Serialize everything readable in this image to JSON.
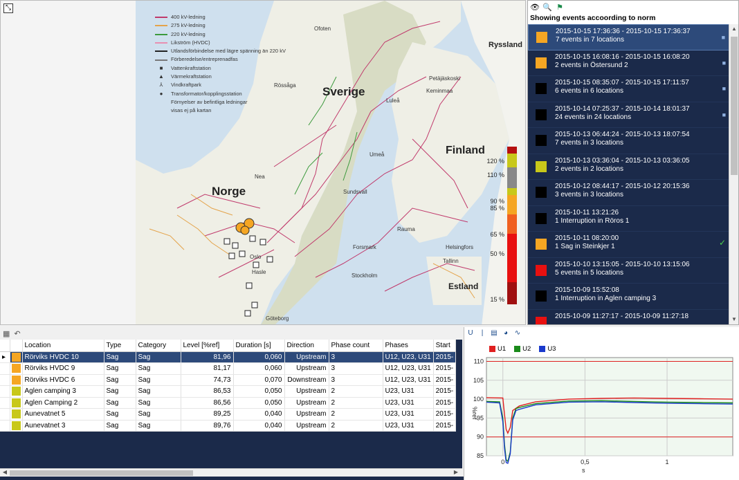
{
  "map": {
    "expand_icon": "expand-icon",
    "legend": [
      {
        "label": "400 kV-ledning",
        "color": "#c0396b",
        "kind": "line"
      },
      {
        "label": "275 kV-ledning",
        "color": "#e4a34a",
        "kind": "line"
      },
      {
        "label": "220 kV-ledning",
        "color": "#3c9a3c",
        "kind": "line"
      },
      {
        "label": "Likström (HVDC)",
        "color": "#e88fb0",
        "kind": "line"
      },
      {
        "label": "Utlandsförbindelse med lägre spänning än 220 kV",
        "color": "#222222",
        "kind": "line"
      },
      {
        "label": "Förberedelse/entreprenadfas",
        "color": "#777777",
        "kind": "line"
      },
      {
        "label": "Vattenkraftstation",
        "symbol": "■",
        "kind": "symbol"
      },
      {
        "label": "Värmekraftstation",
        "symbol": "▲",
        "kind": "symbol"
      },
      {
        "label": "Vindkraftpark",
        "symbol": "⅄",
        "kind": "symbol"
      },
      {
        "label": "Transformator/kopplingsstation",
        "symbol": "●",
        "kind": "symbol"
      },
      {
        "label": "Förnyelser av befintliga ledningar",
        "kind": "note"
      },
      {
        "label": "visas ej på kartan",
        "kind": "note"
      }
    ],
    "countries": {
      "norge": "Norge",
      "sverige": "Sverige",
      "finland": "Finland",
      "estland": "Estland",
      "ryssland": "Ryssland"
    },
    "cities": {
      "ofoten": "Ofoten",
      "rossaga": "Rössåga",
      "lulea": "Luleå",
      "petajaskoski": "Petäjäskoski",
      "keminmaa": "Keminmaa",
      "umea": "Umeå",
      "nea": "Nea",
      "sundsvall": "Sundsvall",
      "rauma": "Rauma",
      "forsmark": "Forsmark",
      "helsingfors": "Helsingfors",
      "tallinn": "Tallinn",
      "oslo": "Oslo",
      "hasle": "Hasle",
      "stockholm": "Stockholm",
      "goteborg": "Göteborg"
    },
    "scale": {
      "labels": [
        "120 %",
        "110 %",
        "90 %",
        "85 %",
        "65 %",
        "50 %",
        "15 %"
      ],
      "colors": [
        "#b51010",
        "#c8c81a",
        "#888888",
        "#c8c81a",
        "#f5a623",
        "#f06020",
        "#e81010",
        "#a01010"
      ]
    }
  },
  "events": {
    "toolbar_icons": [
      "eye-icon",
      "search-icon",
      "flag-icon"
    ],
    "title": "Showing events accoording to norm",
    "items": [
      {
        "time": "2015-10-15 17:36:36 - 2015-10-15 17:36:37",
        "desc": "7 events in 7 locations",
        "color": "#f5a623",
        "marker": "■",
        "selected": true
      },
      {
        "time": "2015-10-15 16:08:16 - 2015-10-15 16:08:20",
        "desc": "2 events in Östersund 2",
        "color": "#f5a623",
        "marker": "■"
      },
      {
        "time": "2015-10-15 08:35:07 - 2015-10-15 17:11:57",
        "desc": "6 events in 6 locations",
        "color": "#000000",
        "marker": "■"
      },
      {
        "time": "2015-10-14 07:25:37 - 2015-10-14 18:01:37",
        "desc": "24 events in 24 locations",
        "color": "#000000",
        "marker": "■"
      },
      {
        "time": "2015-10-13 06:44:24 - 2015-10-13 18:07:54",
        "desc": "7 events in 3 locations",
        "color": "#000000"
      },
      {
        "time": "2015-10-13 03:36:04 - 2015-10-13 03:36:05",
        "desc": "2 events in 2 locations",
        "color": "#c8c81a"
      },
      {
        "time": "2015-10-12 08:44:17 - 2015-10-12 20:15:36",
        "desc": "3 events in 3 locations",
        "color": "#000000"
      },
      {
        "time": "2015-10-11 13:21:26",
        "desc": "1 Interruption in Röros 1",
        "color": "#000000"
      },
      {
        "time": "2015-10-11 08:20:00",
        "desc": "1 Sag in Steinkjer 1",
        "color": "#f5a623",
        "check": "✓"
      },
      {
        "time": "2015-10-10 13:15:05 - 2015-10-10 13:15:06",
        "desc": "5 events in 5 locations",
        "color": "#e81010"
      },
      {
        "time": "2015-10-09 15:52:08",
        "desc": "1 Interruption in Aglen camping 3",
        "color": "#000000"
      },
      {
        "time": "2015-10-09 11:27:17 - 2015-10-09 11:27:18",
        "desc": "",
        "color": "#e81010"
      }
    ]
  },
  "grid": {
    "toolbar_icons": [
      "table-settings-icon",
      "undo-icon"
    ],
    "headers": [
      "Location",
      "Type",
      "Category",
      "Level [%ref]",
      "Duration [s]",
      "Direction",
      "Phase count",
      "Phases",
      "Start"
    ],
    "rows": [
      {
        "color": "#f5a623",
        "location": "Rörviks HVDC 10",
        "type": "Sag",
        "category": "Sag",
        "level": "81,96",
        "duration": "0,060",
        "direction": "Upstream",
        "phase_count": "3",
        "phases": "U12, U23, U31",
        "start": "2015-",
        "selected": true
      },
      {
        "color": "#f5a623",
        "location": "Rörviks HVDC 9",
        "type": "Sag",
        "category": "Sag",
        "level": "81,17",
        "duration": "0,060",
        "direction": "Upstream",
        "phase_count": "3",
        "phases": "U12, U23, U31",
        "start": "2015-"
      },
      {
        "color": "#f5a623",
        "location": "Rörviks HVDC 6",
        "type": "Sag",
        "category": "Sag",
        "level": "74,73",
        "duration": "0,070",
        "direction": "Downstream",
        "phase_count": "3",
        "phases": "U12, U23, U31",
        "start": "2015-"
      },
      {
        "color": "#c8c81a",
        "location": "Aglen camping 3",
        "type": "Sag",
        "category": "Sag",
        "level": "86,53",
        "duration": "0,050",
        "direction": "Upstream",
        "phase_count": "2",
        "phases": "U23, U31",
        "start": "2015-"
      },
      {
        "color": "#c8c81a",
        "location": "Aglen Camping 2",
        "type": "Sag",
        "category": "Sag",
        "level": "86,56",
        "duration": "0,050",
        "direction": "Upstream",
        "phase_count": "2",
        "phases": "U23, U31",
        "start": "2015-"
      },
      {
        "color": "#c8c81a",
        "location": "Aunevatnet 5",
        "type": "Sag",
        "category": "Sag",
        "level": "89,25",
        "duration": "0,040",
        "direction": "Upstream",
        "phase_count": "2",
        "phases": "U23, U31",
        "start": "2015-"
      },
      {
        "color": "#c8c81a",
        "location": "Aunevatnet 3",
        "type": "Sag",
        "category": "Sag",
        "level": "89,76",
        "duration": "0,040",
        "direction": "Upstream",
        "phase_count": "2",
        "phases": "U23, U31",
        "start": "2015-"
      }
    ]
  },
  "chart_toolbar_icons": [
    "magnet-icon",
    "cursor-icon",
    "table-icon",
    "palette-icon",
    "wave-icon"
  ],
  "chart_data": {
    "type": "line",
    "xlabel": "s",
    "ylabel": "%ref",
    "xlim": [
      -0.1,
      1.4
    ],
    "ylim": [
      85,
      111
    ],
    "xticks": [
      "0",
      "0,5",
      "1"
    ],
    "yticks": [
      "85",
      "90",
      "95",
      "100",
      "105",
      "110"
    ],
    "grid": true,
    "legend_position": "top-left",
    "thresholds": [
      110,
      90
    ],
    "series": [
      {
        "name": "U1",
        "color": "#e02020",
        "x": [
          -0.1,
          0.0,
          0.01,
          0.02,
          0.03,
          0.045,
          0.06,
          0.1,
          0.2,
          0.4,
          0.6,
          0.8,
          1.0,
          1.2,
          1.4
        ],
        "y": [
          100.4,
          100.3,
          96,
          92,
          91,
          92.5,
          97,
          98.2,
          99.3,
          100,
          100.2,
          100.3,
          100.2,
          100.1,
          100.0
        ]
      },
      {
        "name": "U2",
        "color": "#1a8a1a",
        "x": [
          -0.1,
          -0.02,
          0.0,
          0.01,
          0.02,
          0.03,
          0.045,
          0.06,
          0.08,
          0.1,
          0.2,
          0.4,
          0.6,
          0.8,
          1.0,
          1.2,
          1.4
        ],
        "y": [
          99.4,
          99.3,
          95,
          88,
          84,
          83.5,
          86,
          95,
          97.5,
          97.8,
          98.8,
          99.5,
          99.6,
          99.4,
          99.2,
          99.1,
          99.0
        ]
      },
      {
        "name": "U3",
        "color": "#1a3acc",
        "x": [
          -0.1,
          -0.02,
          0.0,
          0.01,
          0.02,
          0.03,
          0.045,
          0.06,
          0.08,
          0.1,
          0.2,
          0.4,
          0.6,
          0.8,
          1.0,
          1.2,
          1.4
        ],
        "y": [
          99.2,
          99.0,
          94,
          87,
          83.2,
          83,
          85.5,
          94.5,
          97,
          97.3,
          98.5,
          99.2,
          99.3,
          99.1,
          98.9,
          98.8,
          98.7
        ]
      }
    ]
  }
}
